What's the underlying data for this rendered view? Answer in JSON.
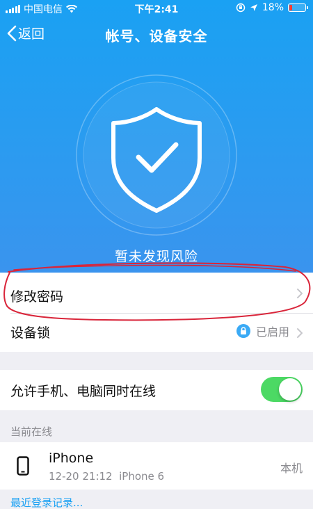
{
  "status_bar": {
    "carrier": "中国电信",
    "time": "下午2:41",
    "battery": "18%",
    "battery_level": 0.18
  },
  "navbar": {
    "back_label": "返回",
    "title": "帐号、设备安全"
  },
  "hero": {
    "risk_text": "暂未发现风险"
  },
  "settings": {
    "change_password": "修改密码",
    "device_lock": "设备锁",
    "device_lock_status": "已启用",
    "allow_online": "允许手机、电脑同时在线",
    "allow_online_enabled": true
  },
  "online": {
    "section_title": "当前在线",
    "device_name": "iPhone",
    "device_detail": "12-20 21:12  iPhone 6",
    "device_tag": "本机"
  },
  "recent_login_link": "最近登录记录...",
  "colors": {
    "header_blue": "#1aa1f3",
    "toggle_green": "#4cd964",
    "annotation_red": "#d9253a"
  }
}
